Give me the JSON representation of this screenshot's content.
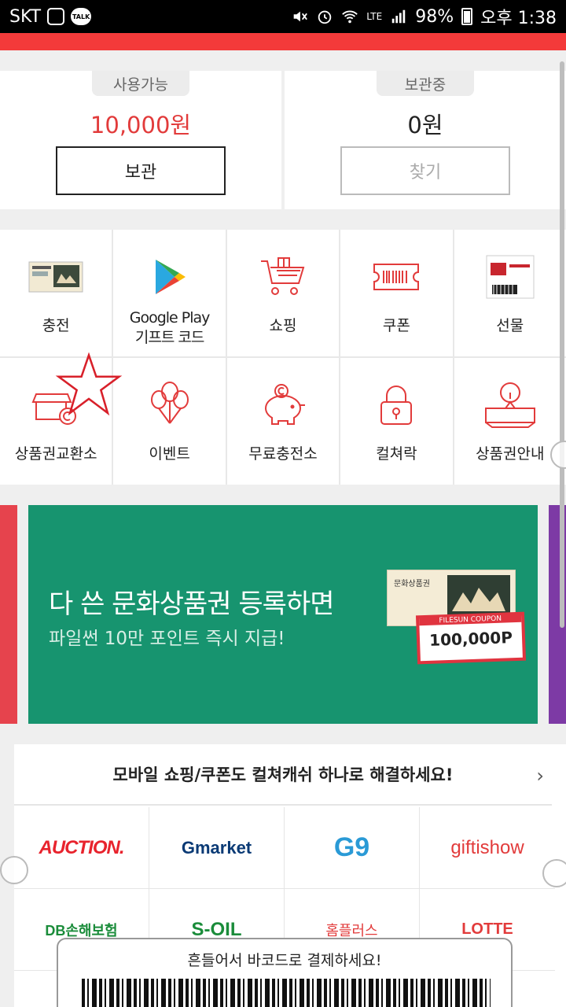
{
  "status_bar": {
    "carrier": "SKT",
    "network": "LTE",
    "battery": "98%",
    "time": "오후 1:38",
    "talk": "TALK"
  },
  "wallet": {
    "available_label": "사용가능",
    "available_amount": "10,000원",
    "store_button": "보관",
    "stored_label": "보관중",
    "stored_amount": "0원",
    "find_button": "찾기"
  },
  "menu": [
    {
      "label": "충전",
      "icon": "gift-card-icon"
    },
    {
      "label": "Google Play\n기프트 코드",
      "icon": "google-play-icon"
    },
    {
      "label": "쇼핑",
      "icon": "shopping-cart-icon"
    },
    {
      "label": "쿠폰",
      "icon": "barcode-ticket-icon"
    },
    {
      "label": "선물",
      "icon": "gift-voucher-icon"
    },
    {
      "label": "상품권교환소",
      "icon": "store-exchange-icon"
    },
    {
      "label": "이벤트",
      "icon": "balloons-icon"
    },
    {
      "label": "무료충전소",
      "icon": "piggy-bank-icon"
    },
    {
      "label": "컬쳐락",
      "icon": "lock-icon"
    },
    {
      "label": "상품권안내",
      "icon": "info-sign-icon"
    }
  ],
  "banner": {
    "headline": "다 쓴 문화상품권 등록하면",
    "subline": "파일썬 10만 포인트 즉시 지급!",
    "ticket_text": "문화상품권",
    "coupon_title": "FILESUN COUPON",
    "coupon_value": "100,000P",
    "colors": {
      "main": "#17946f",
      "prev": "#e6434d",
      "next": "#7d3aa5"
    }
  },
  "shopping": {
    "title": "모바일 쇼핑/쿠폰도 컬쳐캐쉬 하나로 해결하세요!",
    "brands": [
      "AUCTION.",
      "Gmarket",
      "G9",
      "giftishow",
      "DB손해보험",
      "S-OIL",
      "홈플러스",
      "LOTTE"
    ]
  },
  "popup": {
    "text": "흔들어서 바코드로 결제하세요!"
  },
  "accent_color": "#f33a3a"
}
